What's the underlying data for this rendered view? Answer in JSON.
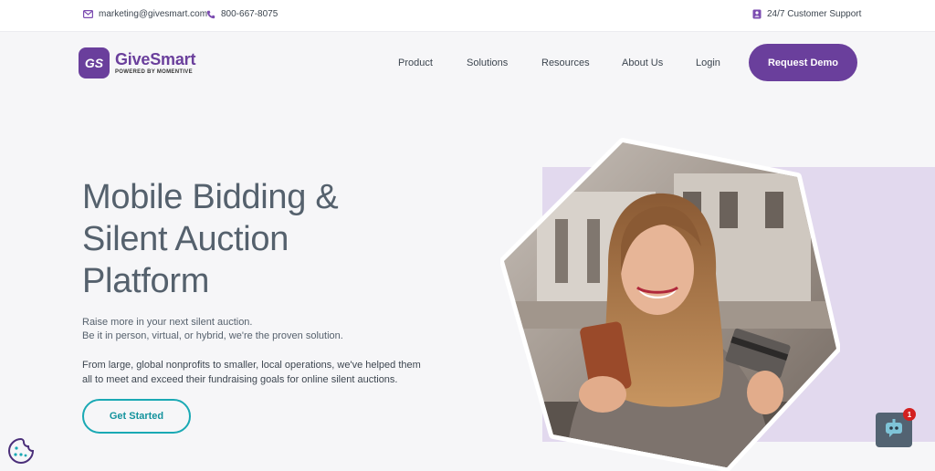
{
  "topbar": {
    "email": "marketing@givesmart.com",
    "phone": "800-667-8075",
    "support": "24/7 Customer Support"
  },
  "brand": {
    "badge": "GS",
    "name": "GiveSmart",
    "tagline": "POWERED BY MOMENTIVE",
    "color": "#6a3f9c"
  },
  "nav": {
    "items": [
      "Product",
      "Solutions",
      "Resources",
      "About Us",
      "Login"
    ],
    "cta": "Request Demo"
  },
  "hero": {
    "title_lines": [
      "Mobile Bidding &",
      "Silent Auction",
      "Platform"
    ],
    "sub_lines": [
      "Raise more in your next silent auction.",
      "Be it in person, virtual, or hybrid, we're the proven solution."
    ],
    "body": "From large, global nonprofits to smaller, local operations, we've helped them all to meet and exceed their fundraising goals for online silent auctions.",
    "cta": "Get Started"
  },
  "chat": {
    "badge_count": "1"
  },
  "icons": {
    "email": "mail-icon",
    "phone": "phone-icon",
    "support": "support-icon",
    "chat": "chatbot-icon",
    "cookie": "cookie-icon"
  },
  "colors": {
    "accent": "#6a3f9c",
    "teal": "#1aa9b4",
    "lavender": "#e2d9ee",
    "badge_red": "#d32020"
  }
}
